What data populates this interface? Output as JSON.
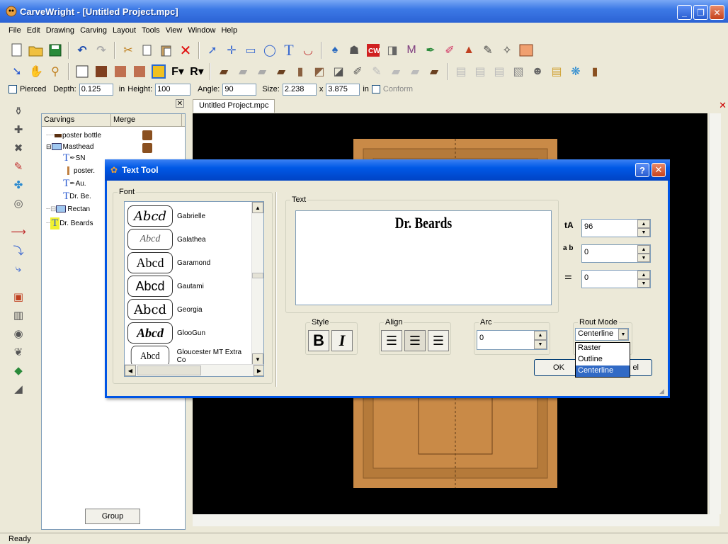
{
  "window": {
    "title": "CarveWright - [Untitled Project.mpc]"
  },
  "menu": [
    "File",
    "Edit",
    "Drawing",
    "Carving",
    "Layout",
    "Tools",
    "View",
    "Window",
    "Help"
  ],
  "propbar": {
    "pierced_label": "Pierced",
    "depth_label": "Depth:",
    "depth_value": "0.125",
    "in_label1": "in",
    "height_label": "Height:",
    "height_value": "100",
    "angle_label": "Angle:",
    "angle_value": "90",
    "size_label": "Size:",
    "size_w": "2.238",
    "x_label": "x",
    "size_h": "3.875",
    "in_label2": "in",
    "conform_label": "Conform"
  },
  "tree": {
    "col_carvings": "Carvings",
    "col_merge": "Merge",
    "items": [
      "poster bottle",
      "Masthead",
      "SN",
      "poster.",
      "Au.",
      "Dr. Be.",
      "Rectan",
      "Dr. Beards"
    ],
    "group_label": "Group"
  },
  "document": {
    "tab_label": "Untitled Project.mpc"
  },
  "status": {
    "text": "Ready"
  },
  "dialog": {
    "title": "Text Tool",
    "font_legend": "Font",
    "fonts": [
      {
        "sample": "Abcd",
        "name": "Gabrielle"
      },
      {
        "sample": "Abcd",
        "name": "Galathea"
      },
      {
        "sample": "Abcd",
        "name": "Garamond"
      },
      {
        "sample": "Abcd",
        "name": "Gautami"
      },
      {
        "sample": "Abcd",
        "name": "Georgia"
      },
      {
        "sample": "Abcd",
        "name": "GlooGun"
      },
      {
        "sample": "Abcd",
        "name": "Gloucester MT Extra Co"
      }
    ],
    "text_legend": "Text",
    "text_value": "Dr. Beards",
    "size_value": "96",
    "spacing_value": "0",
    "line_value": "0",
    "size_icon": "tA",
    "spacing_icon": "a b",
    "style_legend": "Style",
    "bold_label": "B",
    "italic_label": "I",
    "align_legend": "Align",
    "arc_legend": "Arc",
    "arc_value": "0",
    "rout_legend": "Rout Mode",
    "rout_selected": "Centerline",
    "rout_options": [
      "Raster",
      "Outline",
      "Centerline"
    ],
    "ok_label": "OK",
    "cancel_tail": "el"
  }
}
